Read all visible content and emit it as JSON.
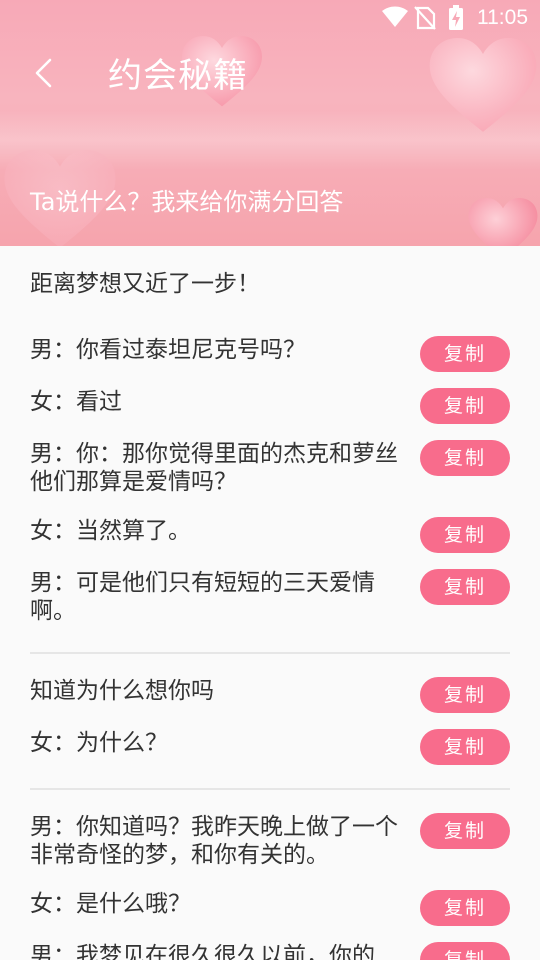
{
  "status": {
    "time": "11:05",
    "icons": [
      "wifi-icon",
      "no-sim-icon",
      "battery-charging-icon"
    ]
  },
  "header": {
    "title": "约会秘籍",
    "subtitle": "Ta说什么？我来给你满分回答",
    "back_icon": "chevron-left-icon"
  },
  "lead": "距离梦想又近了一步！",
  "copy_label": "复制",
  "colors": {
    "accent": "#f86c8c",
    "header": "#f7a9b7"
  },
  "groups": [
    {
      "lines": [
        "男：你看过泰坦尼克号吗？",
        "女：看过",
        "男：你：那你觉得里面的杰克和萝丝他们那算是爱情吗？",
        "女：当然算了。",
        "男：可是他们只有短短的三天爱情啊。"
      ]
    },
    {
      "lines": [
        "知道为什么想你吗",
        "女：为什么？"
      ]
    },
    {
      "lines": [
        "男：你知道吗？我昨天晚上做了一个非常奇怪的梦，和你有关的。",
        "女：是什么哦？",
        "男：我梦见在很久很久以前，你的"
      ]
    }
  ]
}
